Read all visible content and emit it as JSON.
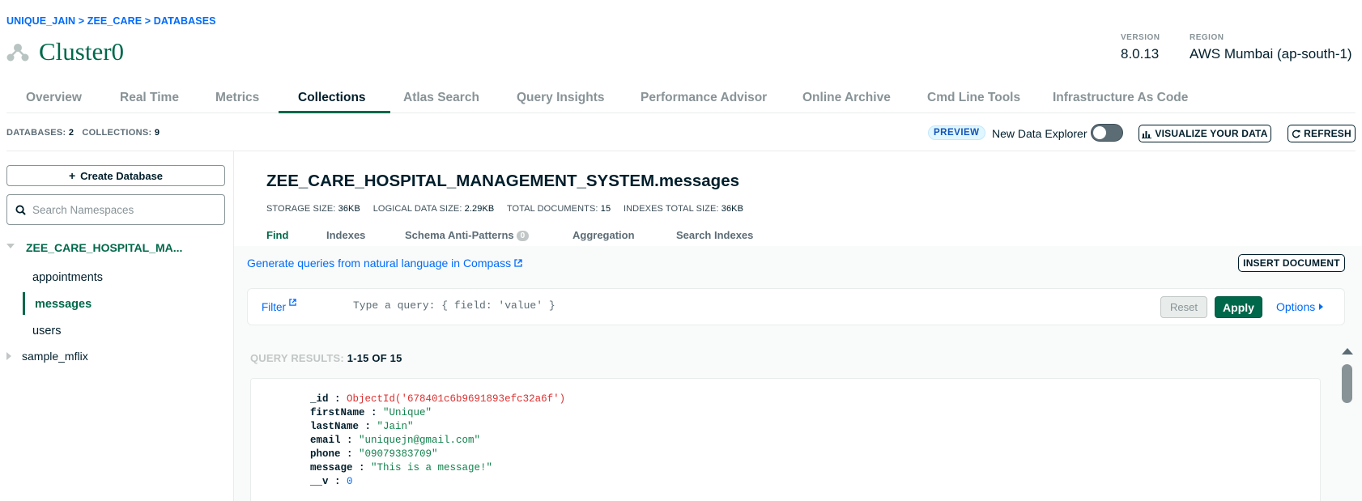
{
  "breadcrumb": {
    "org": "UNIQUE_JAIN",
    "project": "ZEE_CARE",
    "section": "DATABASES",
    "sep": ">"
  },
  "cluster": {
    "name": "Cluster0",
    "icon": "cluster-icon"
  },
  "meta": {
    "version_label": "VERSION",
    "version_value": "8.0.13",
    "region_label": "REGION",
    "region_value": "AWS Mumbai (ap-south-1)"
  },
  "tabs": [
    {
      "label": "Overview"
    },
    {
      "label": "Real Time"
    },
    {
      "label": "Metrics"
    },
    {
      "label": "Collections",
      "active": true
    },
    {
      "label": "Atlas Search"
    },
    {
      "label": "Query Insights"
    },
    {
      "label": "Performance Advisor"
    },
    {
      "label": "Online Archive"
    },
    {
      "label": "Cmd Line Tools"
    },
    {
      "label": "Infrastructure As Code"
    }
  ],
  "counts": {
    "databases_label": "DATABASES:",
    "databases": "2",
    "collections_label": "COLLECTIONS:",
    "collections": "9"
  },
  "toolbar": {
    "preview": "PREVIEW",
    "new_data_explorer": "New Data Explorer",
    "toggle_on": false,
    "visualize": "VISUALIZE YOUR DATA",
    "refresh": "REFRESH"
  },
  "sidebar": {
    "create_database": "Create Database",
    "search_placeholder": "Search Namespaces",
    "databases": [
      {
        "name": "ZEE_CARE_HOSPITAL_MA...",
        "expanded": true,
        "collections": [
          {
            "name": "appointments"
          },
          {
            "name": "messages",
            "active": true
          },
          {
            "name": "users"
          }
        ]
      },
      {
        "name": "sample_mflix",
        "expanded": false
      }
    ]
  },
  "collection": {
    "title": "ZEE_CARE_HOSPITAL_MANAGEMENT_SYSTEM.messages",
    "stats": [
      {
        "label": "STORAGE SIZE:",
        "value": "36KB"
      },
      {
        "label": "LOGICAL DATA SIZE:",
        "value": "2.29KB"
      },
      {
        "label": "TOTAL DOCUMENTS:",
        "value": "15"
      },
      {
        "label": "INDEXES TOTAL SIZE:",
        "value": "36KB"
      }
    ],
    "sub_tabs": [
      {
        "label": "Find",
        "active": true
      },
      {
        "label": "Indexes"
      },
      {
        "label": "Schema Anti-Patterns",
        "badge": "0"
      },
      {
        "label": "Aggregation"
      },
      {
        "label": "Search Indexes"
      }
    ]
  },
  "query": {
    "nl_link": "Generate queries from natural language in Compass",
    "insert_document": "INSERT DOCUMENT",
    "filter_label": "Filter",
    "filter_placeholder": "Type a query: { field: 'value' }",
    "reset": "Reset",
    "apply": "Apply",
    "options": "Options"
  },
  "results": {
    "label": "QUERY RESULTS:",
    "range": "1-15 OF 15",
    "document": [
      {
        "key": "_id",
        "value": "ObjectId('678401c6b9691893efc32a6f')",
        "type": "oid"
      },
      {
        "key": "firstName",
        "value": "\"Unique\"",
        "type": "s"
      },
      {
        "key": "lastName",
        "value": "\"Jain\"",
        "type": "s"
      },
      {
        "key": "email",
        "value": "\"uniquejn@gmail.com\"",
        "type": "s"
      },
      {
        "key": "phone",
        "value": "\"09079383709\"",
        "type": "s"
      },
      {
        "key": "message",
        "value": "\"This is a message!\"",
        "type": "s"
      },
      {
        "key": "__v",
        "value": "0",
        "type": "n"
      }
    ]
  },
  "colors": {
    "brand_green": "#00684a",
    "link_blue": "#016bf8",
    "dark": "#001e2b",
    "string_green": "#12824d",
    "oid_red": "#db3030"
  }
}
